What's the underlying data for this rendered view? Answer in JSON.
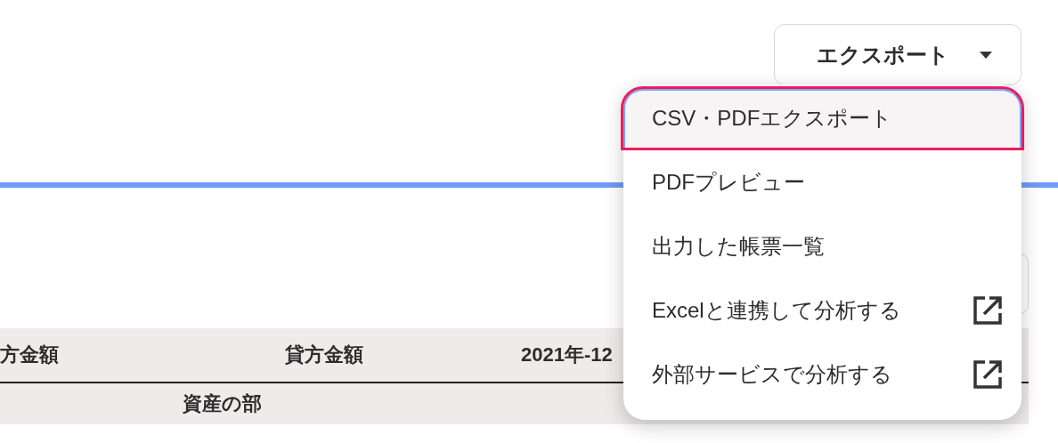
{
  "export_button": {
    "label": "エクスポート",
    "expanded": true
  },
  "menu": {
    "items": [
      {
        "label": "CSV・PDFエクスポート",
        "selected": true,
        "external": false
      },
      {
        "label": "PDFプレビュー",
        "selected": false,
        "external": false
      },
      {
        "label": "出力した帳票一覧",
        "selected": false,
        "external": false
      },
      {
        "label": "Excelと連携して分析する",
        "selected": false,
        "external": true
      },
      {
        "label": "外部サービスで分析する",
        "selected": false,
        "external": true
      }
    ]
  },
  "table": {
    "columns": [
      "方金額",
      "貸方金額",
      "2021年-12"
    ],
    "section_row": "資産の部"
  }
}
